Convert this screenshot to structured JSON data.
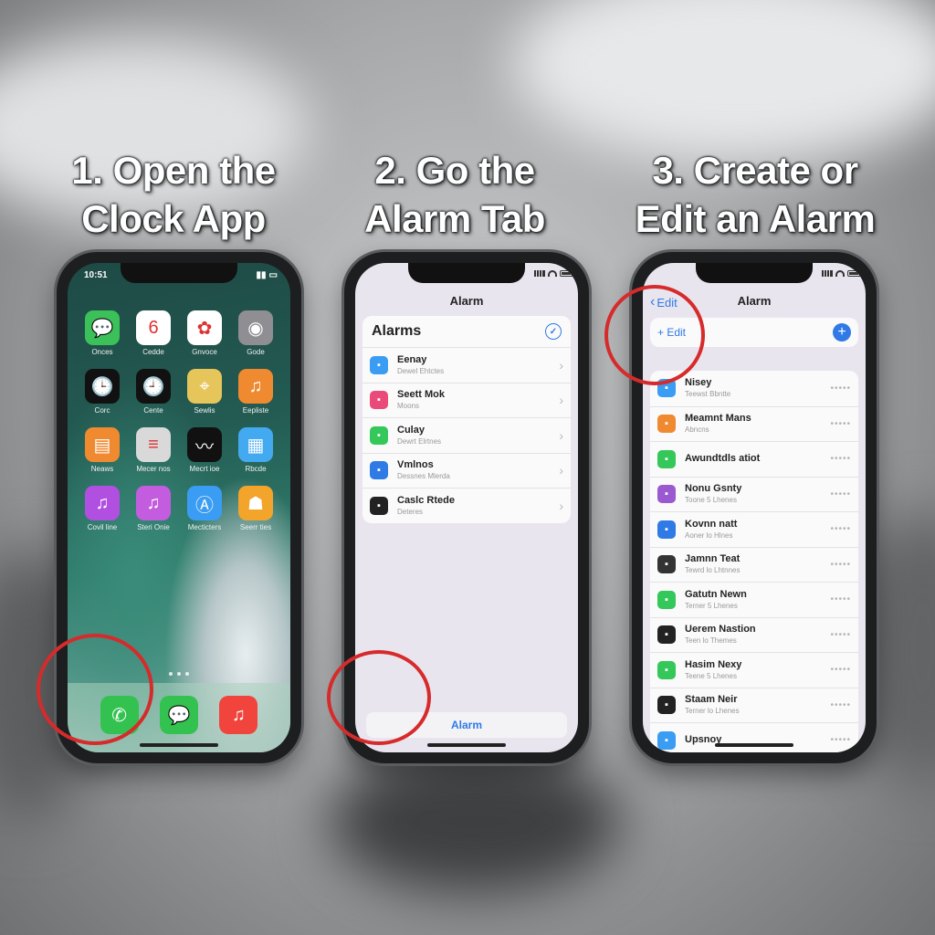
{
  "steps": [
    {
      "line1": "1. Open the",
      "line2": "Clock App"
    },
    {
      "line1": "2. Go the",
      "line2": "Alarm Tab"
    },
    {
      "line1": "3. Create or",
      "line2": "Edit an Alarm"
    }
  ],
  "phone1": {
    "time": "10:51",
    "apps": [
      {
        "label": "Onces",
        "icon": "messages-icon",
        "color": "#3cc05a",
        "glyph": "💬"
      },
      {
        "label": "Cedde",
        "icon": "calendar-icon",
        "color": "#ffffff",
        "glyph": "6"
      },
      {
        "label": "Gnvoce",
        "icon": "photos-icon",
        "color": "#ffffff",
        "glyph": "✿"
      },
      {
        "label": "Gode",
        "icon": "camera-icon",
        "color": "#8e8e93",
        "glyph": "◉"
      },
      {
        "label": "Corc",
        "icon": "clock-icon",
        "color": "#111111",
        "glyph": "🕒"
      },
      {
        "label": "Cente",
        "icon": "clock-icon",
        "color": "#111111",
        "glyph": "🕘"
      },
      {
        "label": "Sewlis",
        "icon": "maps-icon",
        "color": "#e6c55a",
        "glyph": "⌖"
      },
      {
        "label": "Eepliste",
        "icon": "music-icon",
        "color": "#f08a30",
        "glyph": "♫"
      },
      {
        "label": "Neaws",
        "icon": "news-icon",
        "color": "#f08a30",
        "glyph": "▤"
      },
      {
        "label": "Mecer nos",
        "icon": "notes-icon",
        "color": "#d9d9d9",
        "glyph": "≡"
      },
      {
        "label": "Mecrt ioe",
        "icon": "stocks-icon",
        "color": "#111111",
        "glyph": "〰"
      },
      {
        "label": "Rbcde",
        "icon": "clips-icon",
        "color": "#43a9f0",
        "glyph": "▦"
      },
      {
        "label": "Covil line",
        "icon": "itunes-icon",
        "color": "#b14fe0",
        "glyph": "♫"
      },
      {
        "label": "Steri Onie",
        "icon": "music-icon",
        "color": "#c45ce0",
        "glyph": "♫"
      },
      {
        "label": "Mecticters",
        "icon": "appstore-icon",
        "color": "#3a9cf2",
        "glyph": "Ⓐ"
      },
      {
        "label": "Seerr ties",
        "icon": "tips-icon",
        "color": "#f3a42a",
        "glyph": "☗"
      }
    ],
    "dock": [
      {
        "icon": "phone-icon",
        "color": "#33c24f",
        "glyph": "✆"
      },
      {
        "icon": "messages-icon",
        "color": "#33c24f",
        "glyph": "💬"
      },
      {
        "icon": "music-icon",
        "color": "#f0443c",
        "glyph": "♫"
      }
    ]
  },
  "phone2": {
    "nav_title": "Alarm",
    "card_title": "Alarms",
    "rows": [
      {
        "title": "Eenay",
        "sub": "Dewel Ehtctes",
        "color": "#3a9cf2",
        "icon": "calendar-icon"
      },
      {
        "title": "Seett Mok",
        "sub": "Moons",
        "color": "#e94a7a",
        "icon": "message-icon"
      },
      {
        "title": "Culay",
        "sub": "Dewrt Elrtnes",
        "color": "#34c759",
        "icon": "message-icon"
      },
      {
        "title": "Vmlnos",
        "sub": "Dessnes Mlerda",
        "color": "#2f7ae5",
        "icon": "appstore-icon"
      },
      {
        "title": "Caslc Rtede",
        "sub": "Deteres",
        "color": "#222222",
        "icon": "sun-icon"
      }
    ],
    "tab_label": "Alarm"
  },
  "phone3": {
    "back_label": "Edit",
    "nav_title": "Alarm",
    "edit_label": "+ Edit",
    "rows": [
      {
        "title": "Nisey",
        "sub": "Teewst Bbntte",
        "color": "#3a9cf2",
        "icon": "calendar-icon"
      },
      {
        "title": "Meamnt Mans",
        "sub": "Abncns",
        "color": "#f08a30",
        "icon": "news-icon"
      },
      {
        "title": "Awundtdls atiot",
        "sub": "",
        "color": "#34c759",
        "icon": "message-icon"
      },
      {
        "title": "Nonu Gsnty",
        "sub": "Toone 5 Lhenes",
        "color": "#9b59d0",
        "icon": "podcast-icon"
      },
      {
        "title": "Kovnn natt",
        "sub": "Aoner lo Hlnes",
        "color": "#2f7ae5",
        "icon": "appstore-icon"
      },
      {
        "title": "Jamnn Teat",
        "sub": "Tewrd lo Lhtnnes",
        "color": "#333333",
        "icon": "mail-icon"
      },
      {
        "title": "Gatutn Newn",
        "sub": "Terner 5 Lhenes",
        "color": "#34c759",
        "icon": "message-icon"
      },
      {
        "title": "Uerem Nastion",
        "sub": "Teen lo Themes",
        "color": "#222222",
        "icon": "clock-icon"
      },
      {
        "title": "Hasim Nexy",
        "sub": "Teene 5 Lhenes",
        "color": "#34c759",
        "icon": "facetime-icon"
      },
      {
        "title": "Staam Neir",
        "sub": "Terner lo Lhenes",
        "color": "#222222",
        "icon": "mail-icon"
      },
      {
        "title": "Upsnoy",
        "sub": "",
        "color": "#3a9cf2",
        "icon": "mail-icon"
      }
    ],
    "more_glyph": "•••••"
  }
}
